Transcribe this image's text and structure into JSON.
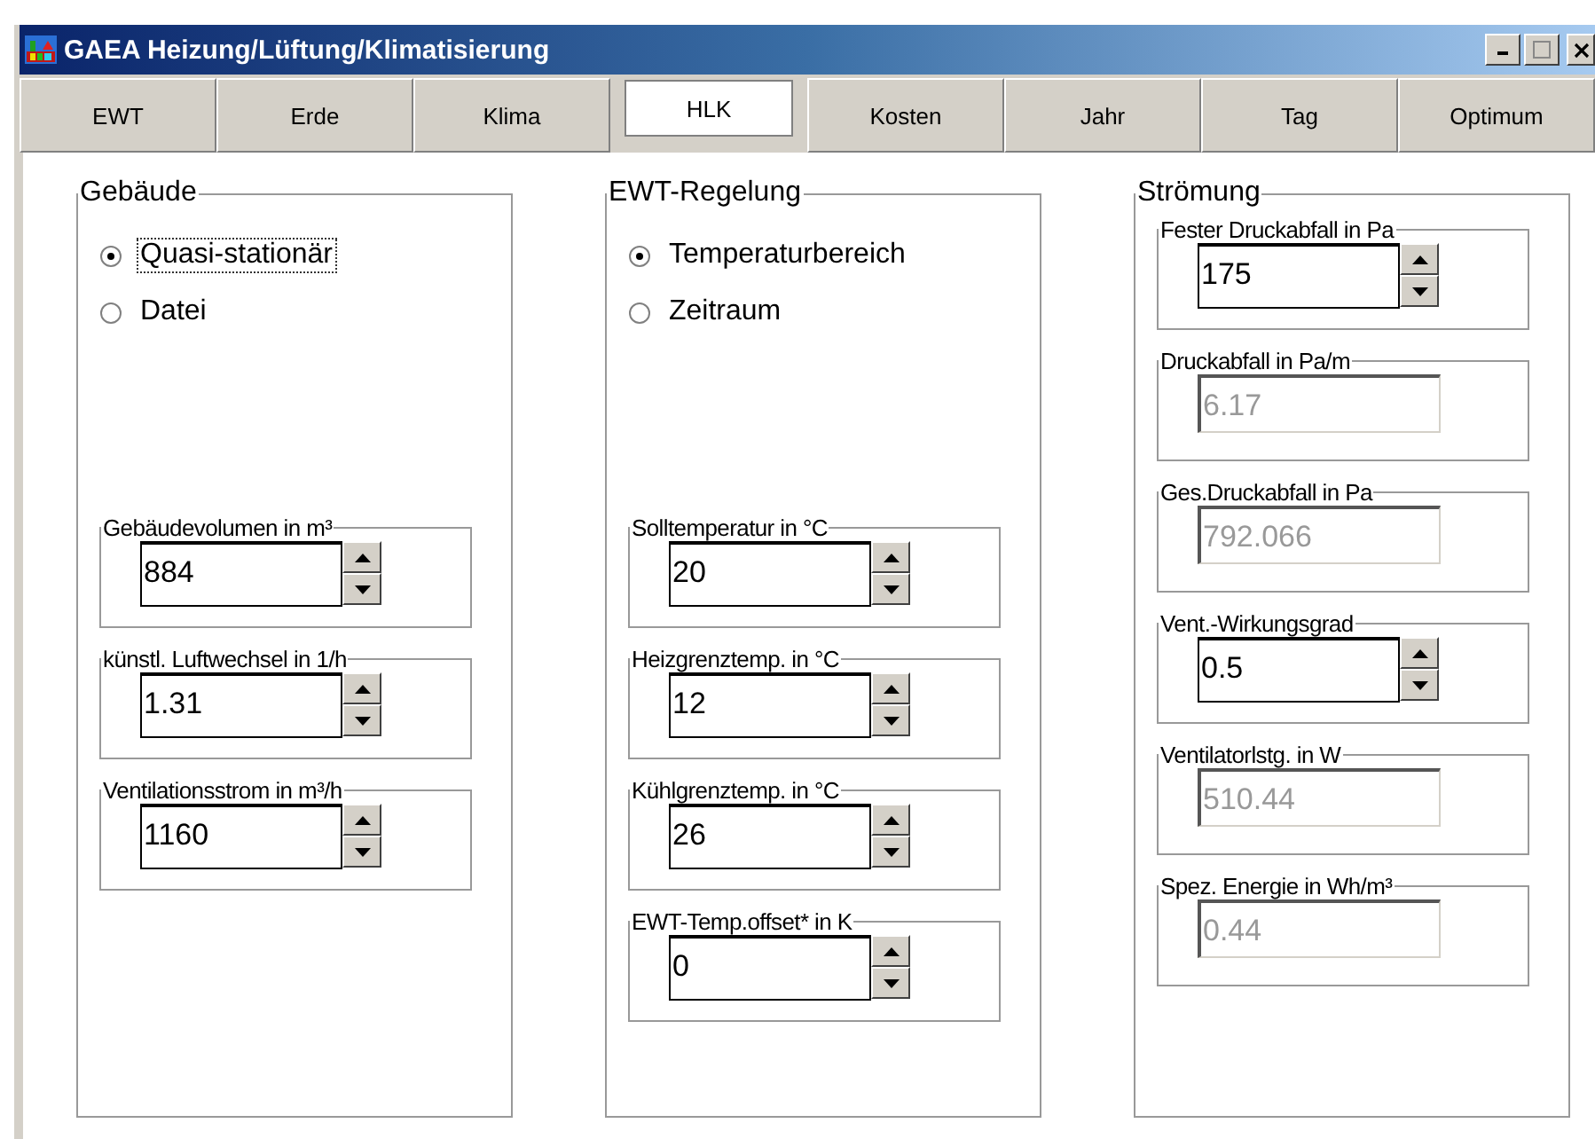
{
  "window": {
    "title": "GAEA Heizung/Lüftung/Klimatisierung"
  },
  "tabs": [
    {
      "label": "EWT",
      "selected": false
    },
    {
      "label": "Erde",
      "selected": false
    },
    {
      "label": "Klima",
      "selected": false
    },
    {
      "label": "HLK",
      "selected": true
    },
    {
      "label": "Kosten",
      "selected": false
    },
    {
      "label": "Jahr",
      "selected": false
    },
    {
      "label": "Tag",
      "selected": false
    },
    {
      "label": "Optimum",
      "selected": false
    }
  ],
  "groups": [
    {
      "title": "Gebäude",
      "radios": [
        {
          "label": "Quasi-stationär",
          "selected": true,
          "focused": true
        },
        {
          "label": "Datei",
          "selected": false,
          "focused": false
        }
      ],
      "fields": [
        {
          "label": "Gebäudevolumen in m³",
          "value": "884",
          "kind": "spin"
        },
        {
          "label": "künstl. Luftwechsel in 1/h",
          "value": "1.31",
          "kind": "spin"
        },
        {
          "label": "Ventilationsstrom in m³/h",
          "value": "1160",
          "kind": "spin"
        }
      ]
    },
    {
      "title": "EWT-Regelung",
      "radios": [
        {
          "label": "Temperaturbereich",
          "selected": true,
          "focused": false
        },
        {
          "label": "Zeitraum",
          "selected": false,
          "focused": false
        }
      ],
      "fields": [
        {
          "label": "Solltemperatur in °C",
          "value": "20",
          "kind": "spin"
        },
        {
          "label": "Heizgrenztemp. in °C",
          "value": "12",
          "kind": "spin"
        },
        {
          "label": "Kühlgrenztemp. in °C",
          "value": "26",
          "kind": "spin"
        },
        {
          "label": "EWT-Temp.offset* in K",
          "value": "0",
          "kind": "spin"
        }
      ]
    },
    {
      "title": "Strömung",
      "fields": [
        {
          "label": "Fester Druckabfall in Pa",
          "value": "175",
          "kind": "spin"
        },
        {
          "label": "Druckabfall in Pa/m",
          "value": "6.17",
          "kind": "readonly"
        },
        {
          "label": "Ges.Druckabfall in Pa",
          "value": "792.066",
          "kind": "readonly"
        },
        {
          "label": "Vent.-Wirkungsgrad",
          "value": "0.5",
          "kind": "spin"
        },
        {
          "label": "Ventilatorlstg. in W",
          "value": "510.44",
          "kind": "readonly"
        },
        {
          "label": "Spez. Energie in Wh/m³",
          "value": "0.44",
          "kind": "readonly"
        }
      ]
    }
  ]
}
